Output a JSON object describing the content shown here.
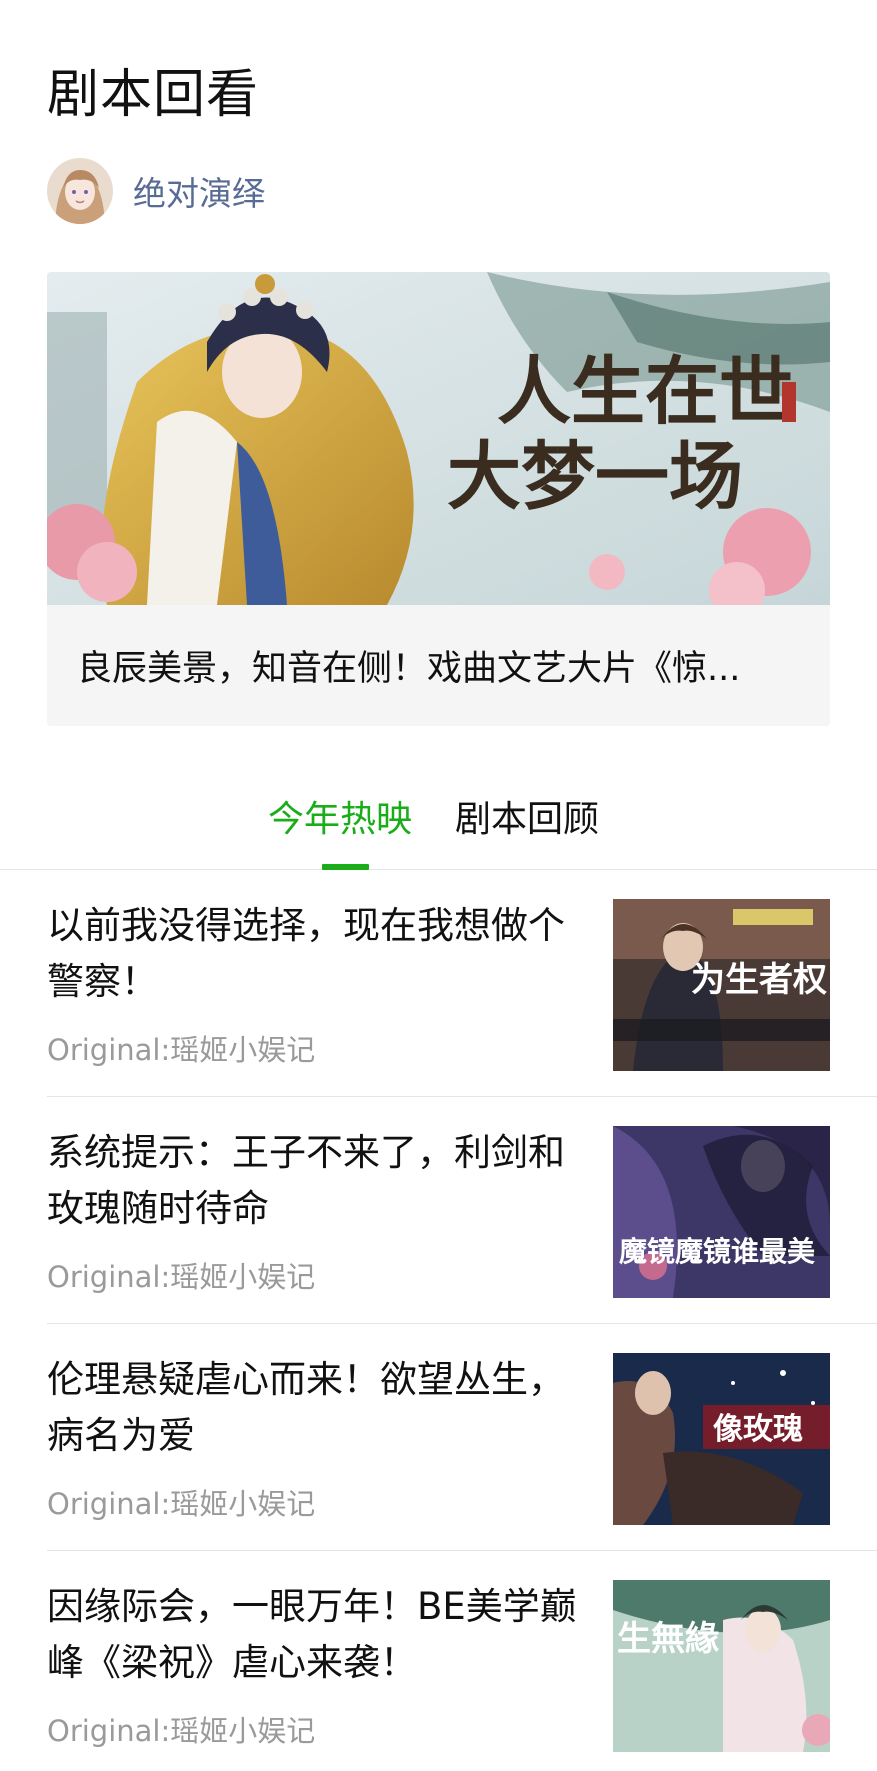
{
  "page": {
    "title": "剧本回看"
  },
  "account": {
    "name": "绝对演绎",
    "avatar_icon": "account-avatar-anime-portrait"
  },
  "banner": {
    "image_text_line1": "人生在世",
    "image_text_line2": "大梦一场",
    "caption": "良辰美景，知音在侧！戏曲文艺大片《惊..."
  },
  "tabs": [
    {
      "label": "今年热映",
      "active": true
    },
    {
      "label": "剧本回顾",
      "active": false
    }
  ],
  "articles": [
    {
      "title": "以前我没得选择，现在我想做个警察！",
      "source": "Original:瑶姬小娱记",
      "thumb_text": "为生者权"
    },
    {
      "title": "系统提示：王子不来了，利剑和玫瑰随时待命",
      "source": "Original:瑶姬小娱记",
      "thumb_text": "魔镜魔镜谁最美"
    },
    {
      "title": "伦理悬疑虐心而来！欲望丛生，病名为爱",
      "source": "Original:瑶姬小娱记",
      "thumb_text": "像玫瑰"
    },
    {
      "title": "因缘际会，一眼万年！BE美学巅峰《梁祝》虐心来袭！",
      "source": "Original:瑶姬小娱记",
      "thumb_text": "生無緣"
    }
  ],
  "colors": {
    "accent": "#1aad19",
    "link": "#576b95",
    "muted": "#9a9a9a"
  }
}
